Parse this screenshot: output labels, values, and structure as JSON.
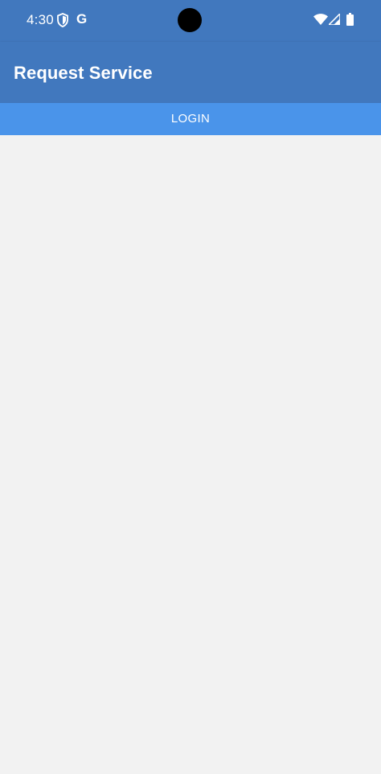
{
  "status_bar": {
    "time": "4:30",
    "g_label": "G",
    "icons": [
      "shield-icon",
      "google-icon",
      "wifi-icon",
      "signal-icon",
      "battery-icon"
    ]
  },
  "app_bar": {
    "title": "Request Service"
  },
  "login": {
    "label": "LOGIN"
  },
  "colors": {
    "primary": "#4178be",
    "login_bar": "#4a94ea",
    "background": "#f2f2f2"
  }
}
